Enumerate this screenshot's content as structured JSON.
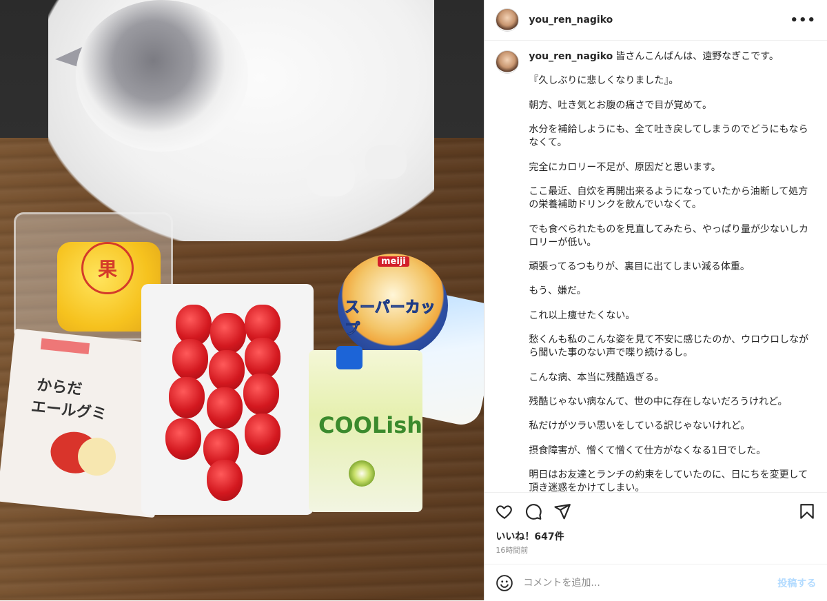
{
  "post": {
    "username": "you_ren_nagiko",
    "menu_icon": "more-horizontal-icon"
  },
  "caption": {
    "username": "you_ren_nagiko",
    "lines": [
      "皆さんこんばんは、遠野なぎこです。",
      "『久しぶりに悲しくなりました』。",
      "朝方、吐き気とお腹の痛さで目が覚めて。",
      "水分を補給しようにも、全て吐き戻してしまうのでどうにもならなくて。",
      "完全にカロリー不足が、原因だと思います。",
      "ここ最近、自炊を再開出来るようになっていたから油断して処方の栄養補助ドリンクを飲んでいなくて。",
      "でも食べられたものを見直してみたら、やっぱり量が少ないしカロリーが低い。",
      "頑張ってるつもりが、裏目に出てしまい減る体重。",
      "もう、嫌だ。",
      "これ以上痩せたくない。",
      "愁くんも私のこんな姿を見て不安に感じたのか、ウロウロしながら聞いた事のない声で喋り続けるし。",
      "こんな病、本当に残酷過ぎる。",
      "残酷じゃない病なんて、世の中に存在しないだろうけれど。",
      "私だけがツラい思いをしている訳じゃないけれど。",
      "摂食障害が、憎くて憎くて仕方がなくなる1日でした。",
      "明日はお友達とランチの約束をしていたのに、日にちを変更して頂き迷惑をかけてしまい。"
    ]
  },
  "photo": {
    "pineapple_seal": "果",
    "gummy_line1": "からだ",
    "gummy_line2": "エールグミ",
    "icecream_brand": "meiji",
    "icecream_name": "スーパーカップ",
    "coolish_logo": "COOLish"
  },
  "actions": {
    "like_icon": "heart-icon",
    "comment_icon": "comment-icon",
    "share_icon": "send-icon",
    "save_icon": "bookmark-icon"
  },
  "likes": "いいね！647件",
  "time_ago": "16時間前",
  "comment": {
    "emoji_icon": "smiley-icon",
    "placeholder": "コメントを追加...",
    "post_label": "投稿する"
  }
}
